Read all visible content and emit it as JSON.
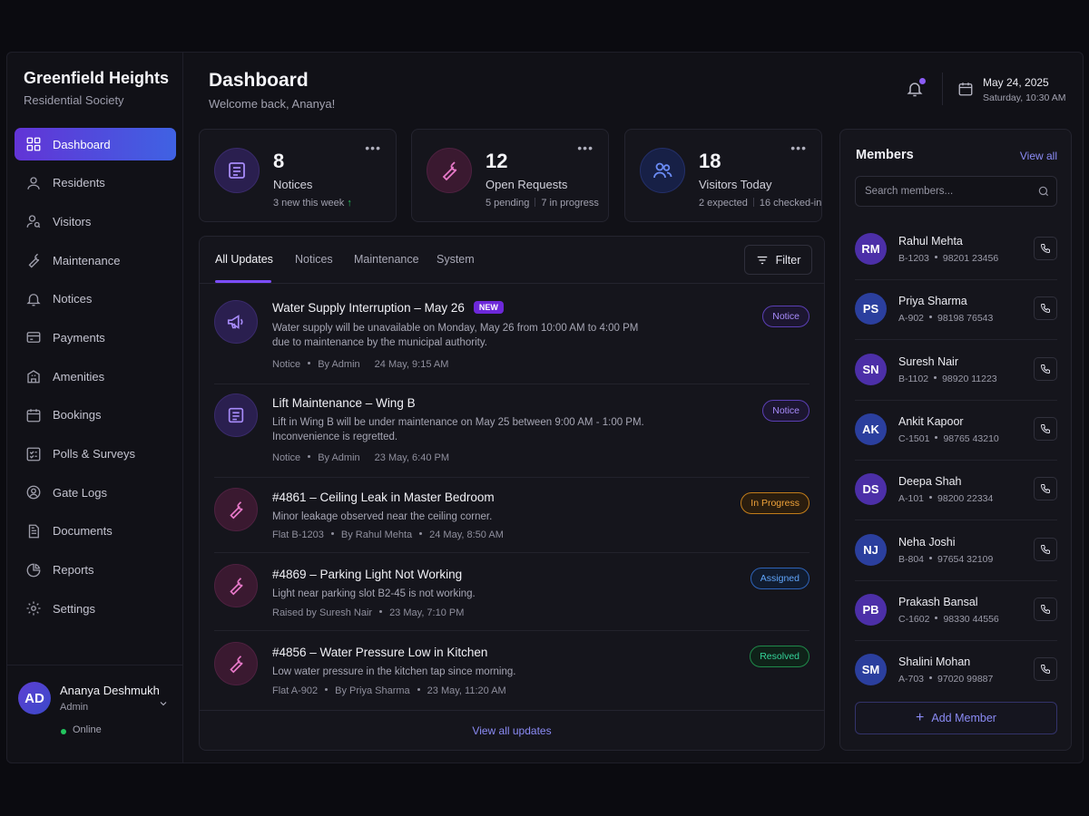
{
  "brand": {
    "title": "Greenfield Heights",
    "subtitle": "Residential Society"
  },
  "nav": [
    {
      "label": "Dashboard",
      "icon": "grid-icon",
      "active": true
    },
    {
      "label": "Residents",
      "icon": "user-icon"
    },
    {
      "label": "Visitors",
      "icon": "visitor-icon"
    },
    {
      "label": "Maintenance",
      "icon": "wrench-icon"
    },
    {
      "label": "Notices",
      "icon": "bell-icon"
    },
    {
      "label": "Payments",
      "icon": "card-icon"
    },
    {
      "label": "Amenities",
      "icon": "building-icon"
    },
    {
      "label": "Bookings",
      "icon": "calendar-icon"
    },
    {
      "label": "Polls & Surveys",
      "icon": "poll-icon"
    },
    {
      "label": "Gate Logs",
      "icon": "gate-icon"
    },
    {
      "label": "Documents",
      "icon": "document-icon"
    },
    {
      "label": "Reports",
      "icon": "pie-chart-icon"
    },
    {
      "label": "Settings",
      "icon": "gear-icon"
    }
  ],
  "user": {
    "initials": "AD",
    "name": "Ananya Deshmukh",
    "role": "Admin",
    "status": "Online"
  },
  "header": {
    "title": "Dashboard",
    "subtitle": "Welcome back, Ananya!",
    "date": "May 24, 2025",
    "time": "Saturday, 10:30 AM"
  },
  "stats": [
    {
      "value": "8",
      "label": "Notices",
      "meta1": "3 new this week",
      "trend": "↑",
      "icon": "notice-icon"
    },
    {
      "value": "12",
      "label": "Open Requests",
      "meta1": "5 pending",
      "meta2": "7 in progress",
      "icon": "wrench-icon"
    },
    {
      "value": "18",
      "label": "Visitors Today",
      "meta1": "2 expected",
      "meta2": "16 checked-in",
      "icon": "people-icon"
    }
  ],
  "updates": {
    "tabs": [
      "All Updates",
      "Notices",
      "Maintenance",
      "System"
    ],
    "filter_label": "Filter",
    "items": [
      {
        "title": "Water Supply Interruption – May 26",
        "new_badge": "NEW",
        "desc": "Water supply will be unavailable on Monday, May 26 from 10:00 AM to 4:00 PM due to maintenance by the municipal authority.",
        "meta": [
          "Notice",
          "By Admin",
          "24 May, 9:15 AM"
        ],
        "badge": "Notice",
        "icon": "megaphone-icon"
      },
      {
        "title": "Lift Maintenance – Wing B",
        "desc": "Lift in Wing B will be under maintenance on May 25 between 9:00 AM - 1:00 PM. Inconvenience is regretted.",
        "meta": [
          "Notice",
          "By Admin",
          "23 May, 6:40 PM"
        ],
        "badge": "Notice",
        "icon": "notice-icon"
      },
      {
        "title": "#4861 – Ceiling Leak in Master Bedroom",
        "desc": "Minor leakage observed near the ceiling corner.",
        "meta": [
          "Flat B-1203",
          "By Rahul Mehta",
          "24 May, 8:50 AM"
        ],
        "badge": "In Progress",
        "icon": "wrench-icon"
      },
      {
        "title": "#4869 – Parking Light Not Working",
        "desc": "Light near parking slot B2-45 is not working.",
        "meta": [
          "Raised by Suresh Nair",
          "23 May, 7:10 PM"
        ],
        "badge": "Assigned",
        "icon": "wrench-icon"
      },
      {
        "title": "#4856 – Water Pressure Low in Kitchen",
        "desc": "Low water pressure in the kitchen tap since morning.",
        "meta": [
          "Flat A-902",
          "By Priya Sharma",
          "23 May, 11:20 AM"
        ],
        "badge": "Resolved",
        "icon": "wrench-icon"
      }
    ],
    "view_all": "View all updates"
  },
  "members": {
    "title": "Members",
    "view_all": "View all",
    "search_placeholder": "Search members...",
    "list": [
      {
        "initials": "RM",
        "name": "Rahul Mehta",
        "flat": "B-1203",
        "phone": "98201 23456",
        "color": "#4c2fa8"
      },
      {
        "initials": "PS",
        "name": "Priya Sharma",
        "flat": "A-902",
        "phone": "98198 76543",
        "color": "#2b3f9e"
      },
      {
        "initials": "SN",
        "name": "Suresh Nair",
        "flat": "B-1102",
        "phone": "98920 11223",
        "color": "#4c2fa8"
      },
      {
        "initials": "AK",
        "name": "Ankit Kapoor",
        "flat": "C-1501",
        "phone": "98765 43210",
        "color": "#2b3f9e"
      },
      {
        "initials": "DS",
        "name": "Deepa Shah",
        "flat": "A-101",
        "phone": "98200 22334",
        "color": "#4c2fa8"
      },
      {
        "initials": "NJ",
        "name": "Neha Joshi",
        "flat": "B-804",
        "phone": "97654 32109",
        "color": "#2b3f9e"
      },
      {
        "initials": "PB",
        "name": "Prakash Bansal",
        "flat": "C-1602",
        "phone": "98330 44556",
        "color": "#4c2fa8"
      },
      {
        "initials": "SM",
        "name": "Shalini Mohan",
        "flat": "A-703",
        "phone": "97020 99887",
        "color": "#2b3f9e"
      }
    ],
    "add_label": "Add Member"
  }
}
